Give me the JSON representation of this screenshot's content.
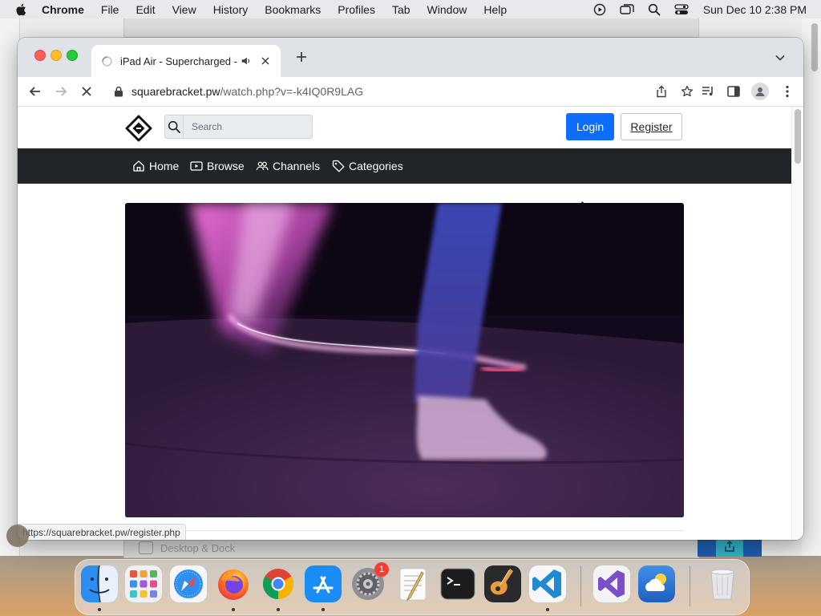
{
  "menubar": {
    "app_name": "Chrome",
    "items": [
      "File",
      "Edit",
      "View",
      "History",
      "Bookmarks",
      "Profiles",
      "Tab",
      "Window",
      "Help"
    ],
    "clock": "Sun Dec 10  2:38 PM"
  },
  "background": {
    "dock_strip_label": "Desktop & Dock"
  },
  "browser": {
    "tab": {
      "title": "iPad Air - Supercharged -",
      "audio_icon": "speaker-icon",
      "loading": true
    },
    "url": {
      "host": "squarebracket.pw",
      "path": "/watch.php?v=-k4IQ0R9LAG"
    },
    "status_url": "https://squarebracket.pw/register.php"
  },
  "site": {
    "search_placeholder": "Search",
    "login_label": "Login",
    "register_label": "Register",
    "nav": {
      "home": "Home",
      "browse": "Browse",
      "channels": "Channels",
      "categories": "Categories"
    },
    "colors": {
      "primary": "#0d6efd",
      "nav_bg": "#212529"
    }
  },
  "dock": {
    "apps": [
      "finder-icon",
      "launchpad-icon",
      "safari-icon",
      "firefox-icon",
      "chrome-icon",
      "app-store-icon",
      "system-settings-icon",
      "textedit-icon",
      "terminal-icon",
      "garageband-icon",
      "vscode-icon",
      "visual-studio-icon",
      "weather-icon",
      "trash-icon"
    ],
    "settings_badge": "1"
  }
}
